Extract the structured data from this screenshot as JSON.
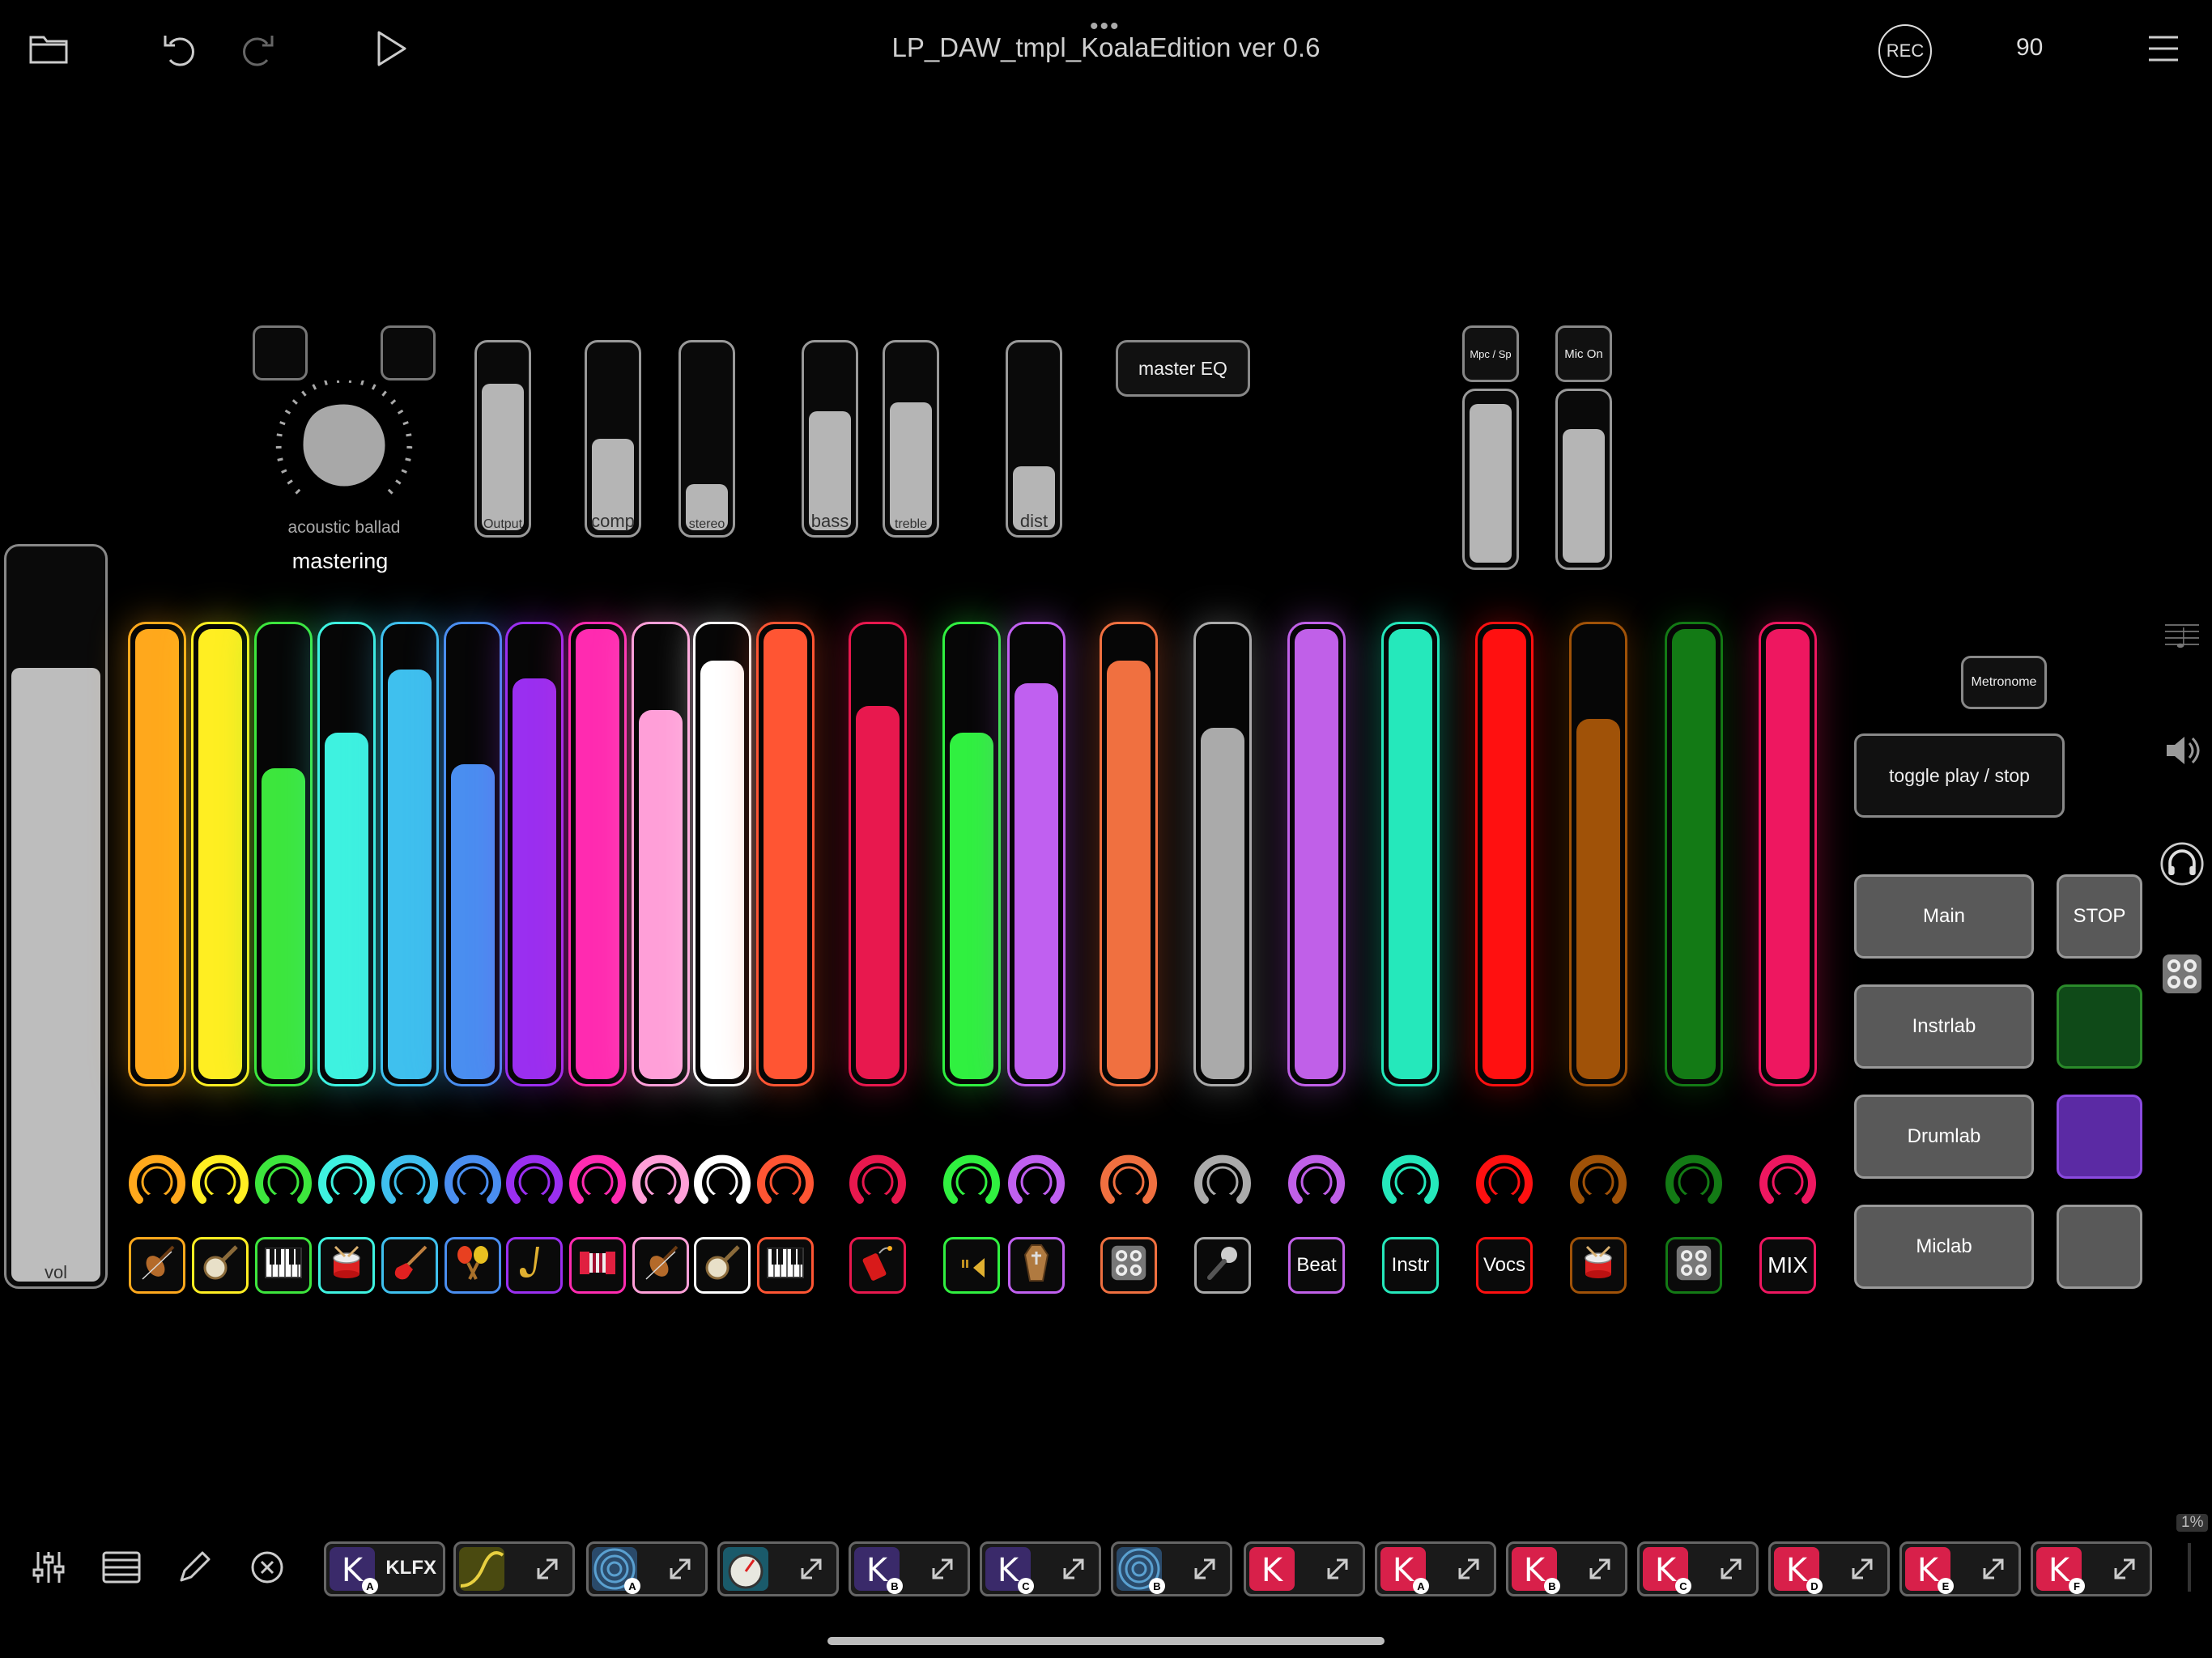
{
  "topbar": {
    "title": "LP_DAW_tmpl_KoalaEdition ver 0.6",
    "dots": "•••",
    "rec_label": "REC",
    "tempo": "90",
    "icons": [
      "folder-icon",
      "undo-icon",
      "redo-icon",
      "play-icon",
      "menu-icon"
    ]
  },
  "mastering": {
    "preset_label": "acoustic ballad",
    "section_label": "mastering",
    "vol_label": "vol",
    "vol_level": 0.84,
    "faders": [
      {
        "label": "Output",
        "level": 0.8
      },
      {
        "label": "comp",
        "level": 0.5
      },
      {
        "label": "stereo",
        "level": 0.25
      },
      {
        "label": "bass",
        "level": 0.65
      },
      {
        "label": "treble",
        "level": 0.7
      },
      {
        "label": "dist",
        "level": 0.35
      }
    ],
    "master_eq_label": "master EQ",
    "mpc_label": "Mpc / Sp",
    "mic_on_label": "Mic On",
    "mpc_level": 0.95,
    "mic_level": 0.8
  },
  "channels": [
    {
      "color": "#ffa81c",
      "level": 1.0,
      "icon": "violin-icon"
    },
    {
      "color": "#ffee22",
      "level": 1.0,
      "icon": "banjo-icon"
    },
    {
      "color": "#3de63d",
      "level": 0.69,
      "icon": "piano-icon"
    },
    {
      "color": "#3ef2e0",
      "level": 0.77,
      "icon": "drum-icon"
    },
    {
      "color": "#3fc0ee",
      "level": 0.91,
      "icon": "electric-guitar-icon"
    },
    {
      "color": "#4a8ef0",
      "level": 0.7,
      "icon": "maracas-icon"
    },
    {
      "color": "#9a2ff0",
      "level": 0.89,
      "icon": "saxophone-icon"
    },
    {
      "color": "#ff2bb0",
      "level": 1.0,
      "icon": "accordion-icon"
    },
    {
      "color": "#ff9fd8",
      "level": 0.82,
      "icon": "violin-icon"
    },
    {
      "color": "#ffffff",
      "level": 0.93,
      "icon": "banjo-icon"
    },
    {
      "color": "#ff5533",
      "level": 1.0,
      "icon": "piano-icon"
    },
    {
      "color": "#e8184e",
      "level": 0.83,
      "icon": "dynamite-icon"
    },
    {
      "color": "#30f040",
      "level": 0.77,
      "icon": "trumpet-icon"
    },
    {
      "color": "#c060f0",
      "level": 0.88,
      "icon": "coffin-icon"
    },
    {
      "color": "#f07040",
      "level": 0.93,
      "icon": "pad-grid-icon"
    },
    {
      "color": "#aaaaaa",
      "level": 0.78,
      "icon": "microphone-icon"
    },
    {
      "color": "#c060e8",
      "level": 1.0,
      "icon": null,
      "text": "Beat"
    },
    {
      "color": "#25e8bb",
      "level": 1.0,
      "icon": null,
      "text": "Instr"
    },
    {
      "color": "#ff1010",
      "level": 1.0,
      "icon": null,
      "text": "Vocs"
    },
    {
      "color": "#a05208",
      "level": 0.8,
      "icon": "drum-icon"
    },
    {
      "color": "#137a15",
      "level": 1.0,
      "icon": "pad-grid-icon"
    },
    {
      "color": "#ee1760",
      "level": 1.0,
      "icon": null,
      "text": "MIX"
    }
  ],
  "right_panel": {
    "metronome_label": "Metronome",
    "toggle_label": "toggle play / stop",
    "main_label": "Main",
    "stop_label": "STOP",
    "instrlab_label": "Instrlab",
    "drumlab_label": "Drumlab",
    "miclab_label": "Miclab",
    "swatch_colors": [
      "#0f4a18",
      "#5b2aa4",
      "#595959"
    ]
  },
  "side_icons": [
    "score-icon",
    "speaker-icon",
    "headphones-icon",
    "pad-grid-icon"
  ],
  "bottombar": {
    "tools": [
      "mixer-icon",
      "list-icon",
      "pencil-icon",
      "close-circle-icon"
    ],
    "plugins": [
      {
        "thumb": "koala-k-icon",
        "badge": "A",
        "color": "#3a2a6a",
        "label": "KLFX"
      },
      {
        "thumb": "filter-curve-icon",
        "badge": "",
        "color": "#4a4a10"
      },
      {
        "thumb": "spiral-icon",
        "badge": "A",
        "color": "#2a4a6a"
      },
      {
        "thumb": "gauge-icon",
        "badge": "",
        "color": "#1a5a6a"
      },
      {
        "thumb": "koala-k-icon",
        "badge": "B",
        "color": "#3a2a6a"
      },
      {
        "thumb": "koala-k-icon",
        "badge": "C",
        "color": "#3a2a6a"
      },
      {
        "thumb": "spiral-icon",
        "badge": "B",
        "color": "#2a4a6a"
      },
      {
        "thumb": "koala-k-icon",
        "badge": "",
        "color": "#d8204a"
      },
      {
        "thumb": "koala-k-icon",
        "badge": "A",
        "color": "#d8204a"
      },
      {
        "thumb": "koala-k-icon",
        "badge": "B",
        "color": "#d8204a"
      },
      {
        "thumb": "koala-k-icon",
        "badge": "C",
        "color": "#d8204a"
      },
      {
        "thumb": "koala-k-icon",
        "badge": "D",
        "color": "#d8204a"
      },
      {
        "thumb": "koala-k-icon",
        "badge": "E",
        "color": "#d8204a"
      },
      {
        "thumb": "koala-k-icon",
        "badge": "F",
        "color": "#d8204a"
      }
    ],
    "cpu_label": "1%"
  }
}
